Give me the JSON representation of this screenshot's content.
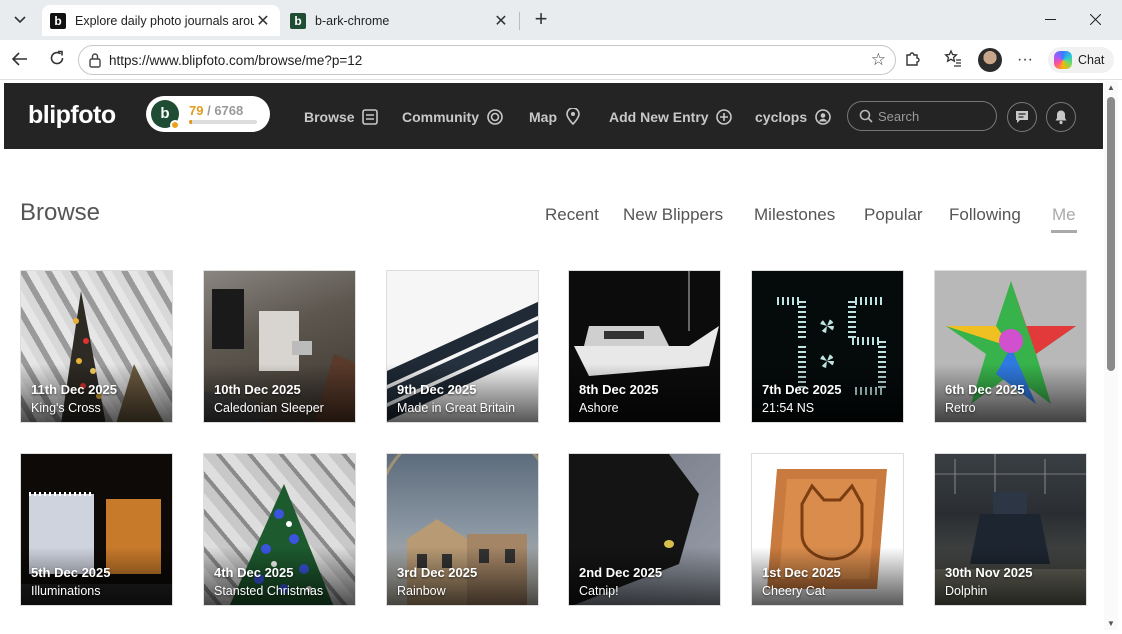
{
  "browser": {
    "tabs": [
      {
        "favicon": "b",
        "title": "Explore daily photo journals aroun",
        "active": true
      },
      {
        "favicon": "b",
        "title": "b-ark-chrome",
        "active": false
      }
    ],
    "url": "https://www.blipfoto.com/browse/me?p=12",
    "chat_label": "Chat"
  },
  "site": {
    "logo": "blipfoto",
    "user": {
      "avatar_letter": "b",
      "current": "79",
      "total": "/ 6768",
      "progress_fraction": 0.0117
    },
    "nav": [
      {
        "label": "Browse",
        "icon": "grid-icon"
      },
      {
        "label": "Community",
        "icon": "community-icon"
      },
      {
        "label": "Map",
        "icon": "map-pin-icon"
      },
      {
        "label": "Add New Entry",
        "icon": "plus-circle-icon"
      },
      {
        "label": "cyclops",
        "icon": "user-icon"
      }
    ],
    "search_placeholder": "Search"
  },
  "browse": {
    "title": "Browse",
    "tabs": [
      "Recent",
      "New Blippers",
      "Milestones",
      "Popular",
      "Following",
      "Me"
    ],
    "active_tab": "Me"
  },
  "entries": [
    {
      "date": "11th Dec 2025",
      "title": "King's Cross"
    },
    {
      "date": "10th Dec 2025",
      "title": "Caledonian Sleeper"
    },
    {
      "date": "9th Dec 2025",
      "title": "Made in Great Britain"
    },
    {
      "date": "8th Dec 2025",
      "title": "Ashore"
    },
    {
      "date": "7th Dec 2025",
      "title": "21:54 NS"
    },
    {
      "date": "6th Dec 2025",
      "title": "Retro"
    },
    {
      "date": "5th Dec 2025",
      "title": "Illuminations"
    },
    {
      "date": "4th Dec 2025",
      "title": "Stansted Christmas"
    },
    {
      "date": "3rd Dec 2025",
      "title": "Rainbow"
    },
    {
      "date": "2nd Dec 2025",
      "title": "Catnip!"
    },
    {
      "date": "1st Dec 2025",
      "title": "Cheery Cat"
    },
    {
      "date": "30th Nov 2025",
      "title": "Dolphin"
    }
  ],
  "colors": {
    "header_bg": "#242424",
    "accent": "#e29b1f",
    "avatar_bg": "#1f4d33"
  }
}
